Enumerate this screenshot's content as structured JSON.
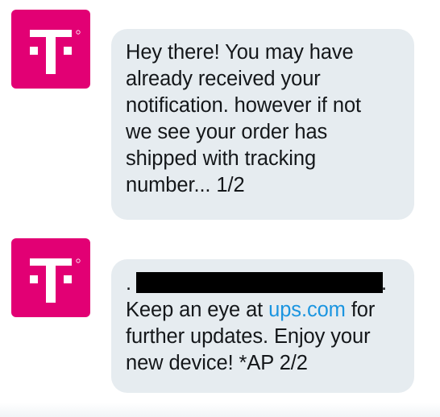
{
  "brand": {
    "name": "T-Mobile",
    "logo_icon": "t-mobile-logo-icon",
    "accent_color": "#e20074"
  },
  "messages": [
    {
      "lines": [
        "Hey there! You may have",
        "already received your",
        "notification. however if not",
        "we see your order has",
        "shipped with tracking",
        "number... 1/2"
      ]
    },
    {
      "redacted_line": {
        "prefix": ".",
        "suffix": "."
      },
      "line1_before_link": "Keep an eye at ",
      "link_text": "ups.com",
      "line1_after_link": " for",
      "lines": [
        "further updates. Enjoy your",
        "new device! *AP 2/2"
      ]
    }
  ],
  "colors": {
    "bubble_bg": "#e6ecf0",
    "text": "#14171a",
    "link": "#1b95e0",
    "redaction": "#000000"
  }
}
